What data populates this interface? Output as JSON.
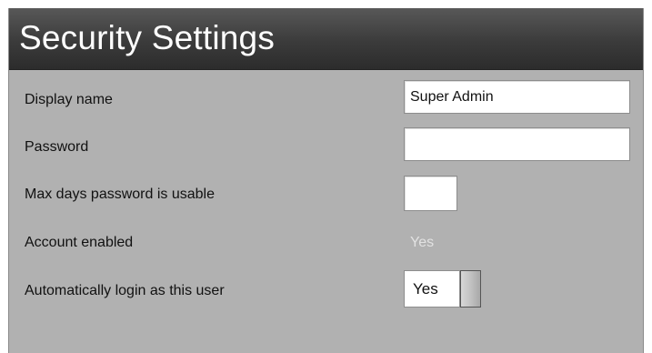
{
  "title": "Security Settings",
  "fields": {
    "display_name": {
      "label": "Display name",
      "value": "Super Admin"
    },
    "password": {
      "label": "Password",
      "value": ""
    },
    "max_days": {
      "label": "Max days password is usable",
      "value": ""
    },
    "account_enabled": {
      "label": "Account enabled",
      "value": "Yes"
    },
    "auto_login": {
      "label": "Automatically login as this user",
      "value": "Yes"
    }
  },
  "colors": {
    "panel_background": "#b1b1b1",
    "titlebar": "#3b3b3b",
    "disabled_text": "#e2e2e2"
  }
}
